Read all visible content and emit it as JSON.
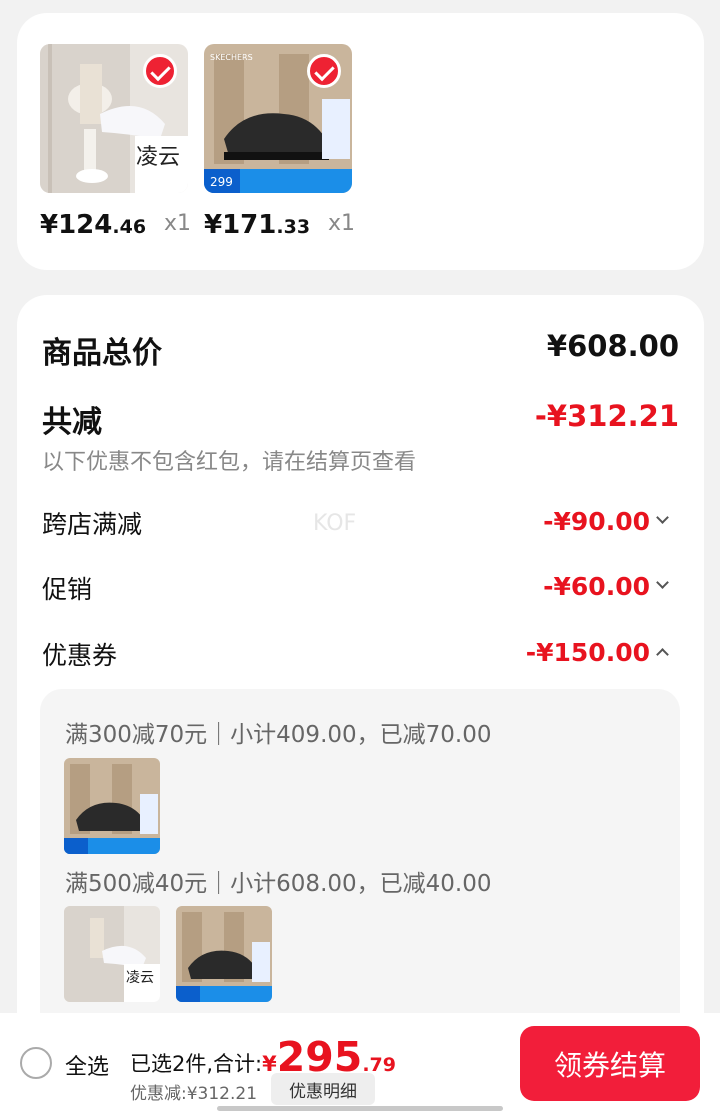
{
  "products": [
    {
      "image": "white-sneaker-model-photo",
      "overlay_text": "凌云",
      "price_int": "¥124",
      "price_dec": ".46",
      "qty": "x1"
    },
    {
      "image": "black-sneaker-photo",
      "brand_text": "SKECHERS",
      "price_tag": "299",
      "price_int": "¥171",
      "price_dec": ".33",
      "qty": "x1"
    }
  ],
  "summary": {
    "total_label": "商品总价",
    "total_value": "¥608.00",
    "discount_label": "共减",
    "discount_value": "-¥312.21",
    "note": "以下优惠不包含红包，请在结算页查看",
    "watermark": "KOF",
    "rows": [
      {
        "label": "跨店满减",
        "value": "-¥90.00",
        "icon": "chevron-down-icon"
      },
      {
        "label": "促销",
        "value": "-¥60.00",
        "icon": "chevron-down-icon"
      },
      {
        "label": "优惠券",
        "value": "-¥150.00",
        "icon": "chevron-up-icon"
      }
    ],
    "coupons": [
      {
        "text": "满300减70元｜小计409.00，已减70.00"
      },
      {
        "text": "满500减40元｜小计608.00，已减40.00"
      }
    ]
  },
  "bottom_bar": {
    "select_all": "全选",
    "selected_text": "已选2件,合计:",
    "currency": "¥",
    "total_int": "295",
    "total_dec": ".79",
    "discount_text": "优惠减:¥312.21",
    "detail_button": "优惠明细",
    "checkout_button": "领券结算"
  },
  "colors": {
    "accent": "#e8131f",
    "checkout": "#f21e3a"
  }
}
